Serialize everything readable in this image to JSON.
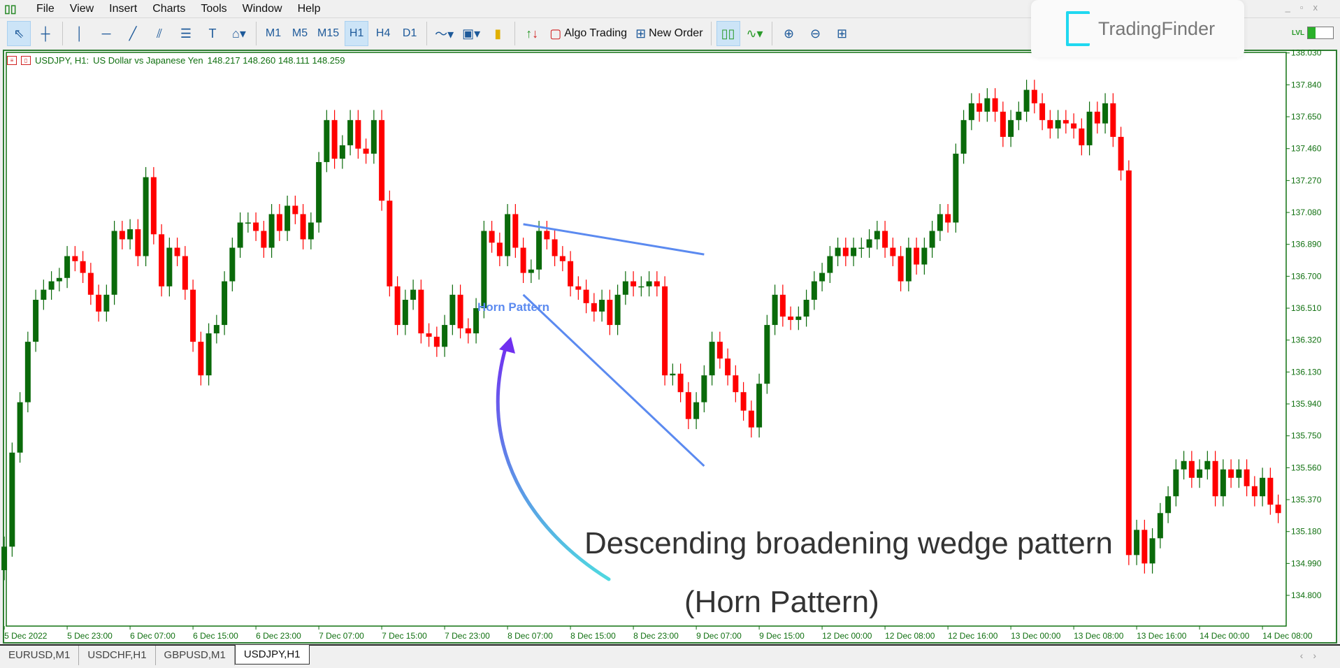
{
  "menu": {
    "items": [
      "File",
      "View",
      "Insert",
      "Charts",
      "Tools",
      "Window",
      "Help"
    ]
  },
  "toolbar": {
    "timeframes": [
      "M1",
      "M5",
      "M15",
      "H1",
      "H4",
      "D1"
    ],
    "active_timeframe": "H1",
    "algo_trading": "Algo Trading",
    "new_order": "New Order",
    "icons": [
      "cursor-icon",
      "crosshair-icon",
      "vertical-line-icon",
      "horizontal-line-icon",
      "trendline-icon",
      "channel-icon",
      "fibonacci-icon",
      "text-icon",
      "shapes-icon",
      "indicators-icon",
      "templates-icon",
      "profiles-icon",
      "buy-sell-icon",
      "candlestick-icon",
      "line-chart-icon",
      "zoom-in-icon",
      "zoom-out-icon",
      "tile-windows-icon"
    ]
  },
  "logo": {
    "text": "TradingFinder"
  },
  "lvl": {
    "label": "LVL",
    "level": 0.3
  },
  "chart": {
    "symbol": "USDJPY, H1:",
    "description": "US Dollar vs Japanese Yen",
    "ohlc": "148.217 148.260 148.111 148.259",
    "colors": {
      "bull": "#0a6a0a",
      "bear": "#ff0000",
      "axis": "#107010",
      "trendline": "#5b8af0",
      "label": "#5b8af0"
    }
  },
  "chart_data": {
    "type": "candlestick",
    "price_ticks": [
      "138.030",
      "137.840",
      "137.650",
      "137.460",
      "137.270",
      "137.080",
      "136.890",
      "136.700",
      "136.510",
      "136.320",
      "136.130",
      "135.940",
      "135.750",
      "135.560",
      "135.370",
      "135.180",
      "134.990",
      "134.800"
    ],
    "time_ticks": [
      "5 Dec 2022",
      "5 Dec 23:00",
      "6 Dec 07:00",
      "6 Dec 15:00",
      "6 Dec 23:00",
      "7 Dec 07:00",
      "7 Dec 15:00",
      "7 Dec 23:00",
      "8 Dec 07:00",
      "8 Dec 15:00",
      "8 Dec 23:00",
      "9 Dec 07:00",
      "9 Dec 15:00",
      "12 Dec 00:00",
      "12 Dec 08:00",
      "12 Dec 16:00",
      "13 Dec 00:00",
      "13 Dec 08:00",
      "13 Dec 16:00",
      "14 Dec 00:00",
      "14 Dec 08:00"
    ],
    "ylim": [
      134.72,
      138.05
    ],
    "closes": [
      135.09,
      135.65,
      135.95,
      136.31,
      136.56,
      136.62,
      136.67,
      136.69,
      136.82,
      136.79,
      136.72,
      136.59,
      136.49,
      136.59,
      136.97,
      136.92,
      136.98,
      136.82,
      137.29,
      136.95,
      136.64,
      136.87,
      136.82,
      136.62,
      136.31,
      136.11,
      136.36,
      136.41,
      136.67,
      136.87,
      137.02,
      137.02,
      136.97,
      136.87,
      137.07,
      136.97,
      137.12,
      137.07,
      136.92,
      137.02,
      137.38,
      137.63,
      137.4,
      137.48,
      137.63,
      137.46,
      137.43,
      137.63,
      137.15,
      136.64,
      136.41,
      136.56,
      136.62,
      136.36,
      136.34,
      136.28,
      136.41,
      136.59,
      136.39,
      136.36,
      136.51,
      136.97,
      136.9,
      136.82,
      137.07,
      136.87,
      136.72,
      136.74,
      136.97,
      136.92,
      136.82,
      136.79,
      136.64,
      136.62,
      136.54,
      136.49,
      136.56,
      136.41,
      136.59,
      136.67,
      136.64,
      136.64,
      136.67,
      136.64,
      136.11,
      136.12,
      136.01,
      135.85,
      135.95,
      136.11,
      136.31,
      136.21,
      136.11,
      136.01,
      135.9,
      135.8,
      136.06,
      136.41,
      136.59,
      136.46,
      136.44,
      136.46,
      136.56,
      136.67,
      136.72,
      136.82,
      136.87,
      136.82,
      136.87,
      136.87,
      136.92,
      136.97,
      136.87,
      136.82,
      136.67,
      136.87,
      136.77,
      136.87,
      136.97,
      137.07,
      137.02,
      137.43,
      137.63,
      137.73,
      137.68,
      137.76,
      137.68,
      137.53,
      137.63,
      137.68,
      137.81,
      137.73,
      137.63,
      137.58,
      137.63,
      137.61,
      137.58,
      137.48,
      137.68,
      137.61,
      137.73,
      137.53,
      137.33,
      135.04,
      135.19,
      134.99,
      135.14,
      135.29,
      135.39,
      135.55,
      135.6,
      135.5,
      135.55,
      135.6,
      135.39,
      135.55,
      135.5,
      135.55,
      135.45,
      135.39,
      135.5,
      135.34,
      135.29
    ],
    "trendlines": [
      {
        "from": {
          "time": "8 Dec 09:00",
          "price": 137.01
        },
        "to": {
          "time": "9 Dec 08:00",
          "price": 136.83
        }
      },
      {
        "from": {
          "time": "8 Dec 09:00",
          "price": 136.59
        },
        "to": {
          "time": "9 Dec 08:00",
          "price": 135.57
        }
      }
    ],
    "pattern_label": "Horn Pattern",
    "annotation_line1": "Descending broadening wedge pattern",
    "annotation_line2": "(Horn Pattern)"
  },
  "tabs": [
    {
      "label": "EURUSD,M1"
    },
    {
      "label": "USDCHF,H1"
    },
    {
      "label": "GBPUSD,M1"
    },
    {
      "label": "USDJPY,H1",
      "active": true
    }
  ]
}
